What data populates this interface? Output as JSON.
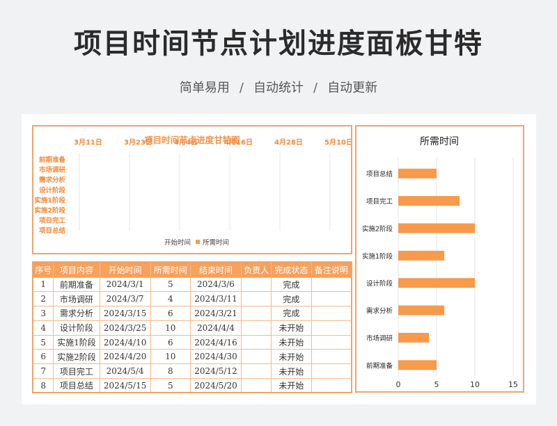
{
  "header": {
    "title": "项目时间节点计划进度面板甘特",
    "subtitle_parts": [
      "简单易用",
      "/",
      "自动统计",
      "/",
      "自动更新"
    ]
  },
  "colors": {
    "accent": "#f6a15c",
    "border": "#f0a46a",
    "label": "#f08a3c",
    "bar": "#f79a4c"
  },
  "gantt": {
    "title": "项目时间节点进度甘特图",
    "date_labels": [
      "3月11日",
      "3月23日",
      "4月4日",
      "4月16日",
      "4月28日",
      "5月10日"
    ],
    "categories": [
      "前期准备",
      "市场调研",
      "需求分析",
      "设计阶段",
      "实施1阶段",
      "实施2阶段",
      "项目完工",
      "项目总结"
    ],
    "legend": [
      "开始时间",
      "所需时间"
    ]
  },
  "table": {
    "headers": [
      "序号",
      "项目内容",
      "开始时间",
      "所需时间",
      "结束时间",
      "负责人",
      "完成状态",
      "备注说明"
    ],
    "rows": [
      [
        "1",
        "前期准备",
        "2024/3/1",
        "5",
        "2024/3/6",
        "",
        "完成",
        ""
      ],
      [
        "2",
        "市场调研",
        "2024/3/7",
        "4",
        "2024/3/11",
        "",
        "完成",
        ""
      ],
      [
        "3",
        "需求分析",
        "2024/3/15",
        "6",
        "2024/3/21",
        "",
        "完成",
        ""
      ],
      [
        "4",
        "设计阶段",
        "2024/3/25",
        "10",
        "2024/4/4",
        "",
        "未开始",
        ""
      ],
      [
        "5",
        "实施1阶段",
        "2024/4/10",
        "6",
        "2024/4/16",
        "",
        "未开始",
        ""
      ],
      [
        "6",
        "实施2阶段",
        "2024/4/20",
        "10",
        "2024/4/30",
        "",
        "未开始",
        ""
      ],
      [
        "7",
        "项目完工",
        "2024/5/4",
        "8",
        "2024/5/12",
        "",
        "未开始",
        ""
      ],
      [
        "8",
        "项目总结",
        "2024/5/15",
        "5",
        "2024/5/20",
        "",
        "未开始",
        ""
      ]
    ]
  },
  "chart_data": {
    "type": "bar",
    "orientation": "horizontal",
    "title": "所需时间",
    "categories": [
      "项目总结",
      "项目完工",
      "实施2阶段",
      "实施1阶段",
      "设计阶段",
      "需求分析",
      "市场调研",
      "前期准备"
    ],
    "values": [
      5,
      8,
      10,
      6,
      10,
      6,
      4,
      5
    ],
    "xlim": [
      0,
      15
    ],
    "xticks": [
      "0",
      "5",
      "10",
      "15"
    ],
    "grid": true
  }
}
